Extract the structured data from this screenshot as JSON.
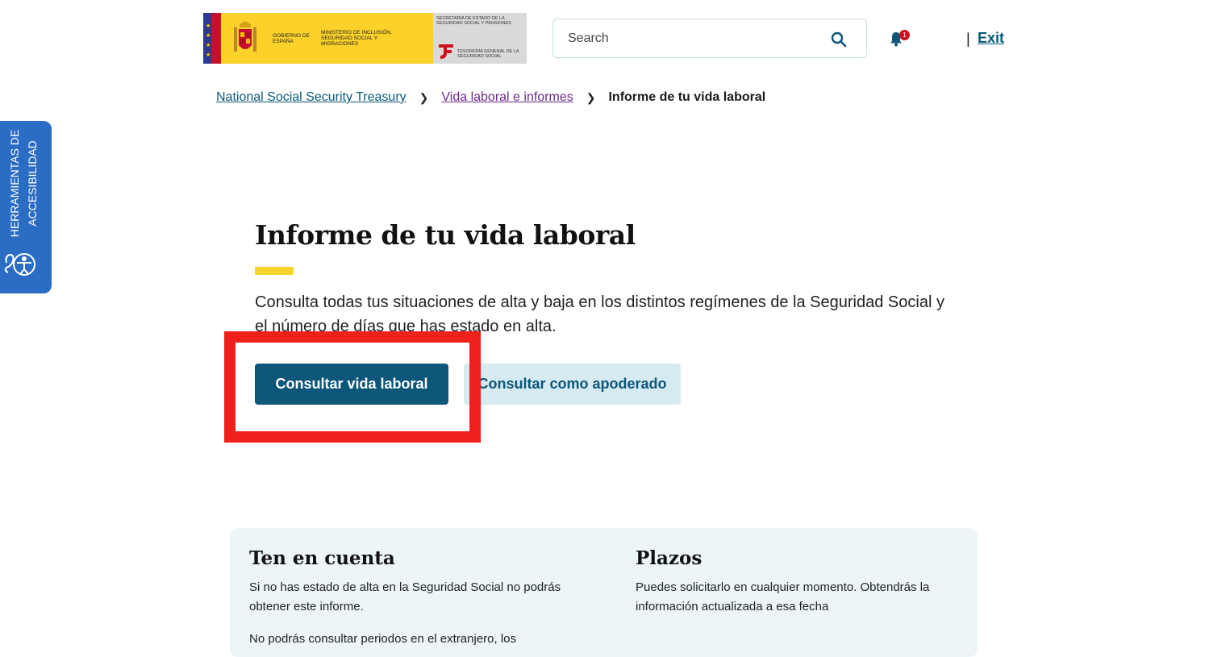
{
  "header": {
    "logo": {
      "gobierno": "GOBIERNO DE ESPAÑA",
      "ministerio": "MINISTERIO DE INCLUSIÓN, SEGURIDAD SOCIAL Y MIGRACIONES",
      "secretaria": "SECRETARÍA DE ESTADO DE LA SEGURIDAD SOCIAL Y PENSIONES",
      "tesoreria": "TESORERÍA GENERAL DE LA SEGURIDAD SOCIAL"
    },
    "search": {
      "placeholder": "Search",
      "icon": "search-icon"
    },
    "notifications": {
      "icon": "bell-icon",
      "count": "1"
    },
    "separator": "|",
    "exit_label": "Exit"
  },
  "breadcrumb": {
    "items": [
      {
        "label": "National Social Security Treasury "
      },
      {
        "label": "Vida laboral e informes "
      }
    ],
    "current": "Informe de tu vida laboral"
  },
  "accessibility": {
    "label": "HERRAMIENTAS DE ACCESIBILIDAD",
    "icon": "accessibility-person-icon"
  },
  "main": {
    "title": "Informe de tu vida laboral",
    "description": "Consulta todas tus situaciones de alta y baja en los distintos regímenes de la Seguridad Social y el número de días que has estado en alta.",
    "primary_button": "Consultar vida laboral",
    "secondary_button": "Consultar como apoderado"
  },
  "info": {
    "ten_en_cuenta": {
      "title": "Ten en cuenta",
      "paragraphs": [
        "Si no has estado de alta en la Seguridad Social no podrás obtener este informe.",
        "No podrás consultar periodos en el extranjero, los"
      ]
    },
    "plazos": {
      "title": "Plazos",
      "text": "Puedes solicitarlo en cualquier momento. Obtendrás la información actualizada a esa fecha"
    }
  },
  "colors": {
    "primary": "#0c5679",
    "secondary_bg": "#d6eaf1",
    "accent_yellow": "#f8d52c",
    "highlight_red": "#f0201c",
    "accessibility_blue": "#2b6cc4"
  }
}
